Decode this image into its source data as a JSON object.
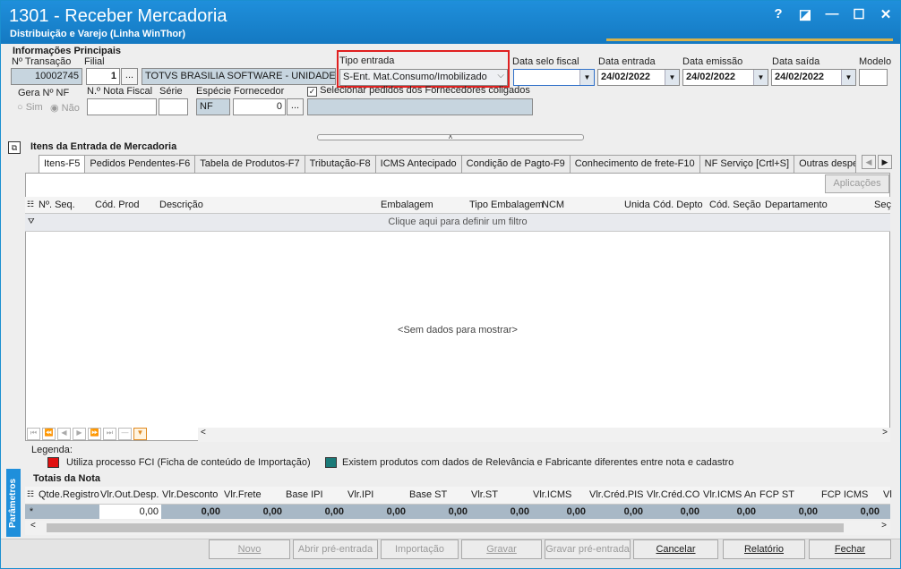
{
  "window": {
    "title": "1301 - Receber Mercadoria",
    "subtitle": "Distribuição e Varejo (Linha WinThor)",
    "controls": [
      "?",
      "◪",
      "—",
      "☐",
      "✕"
    ]
  },
  "main_info": {
    "section_title": "Informações Principais",
    "n_transacao_label": "Nº Transação",
    "n_transacao_value": "10002745",
    "filial_label": "Filial",
    "filial_value": "1",
    "filial_name": "TOTVS BRASILIA SOFTWARE - UNIDADE GOI",
    "tipo_entrada_label": "Tipo entrada",
    "tipo_entrada_value": "S-Ent. Mat.Consumo/Imobilizado",
    "data_selo_label": "Data selo fiscal",
    "data_selo_value": "",
    "data_entrada_label": "Data entrada",
    "data_entrada_value": "24/02/2022",
    "data_emissao_label": "Data emissão",
    "data_emissao_value": "24/02/2022",
    "data_saida_label": "Data saída",
    "data_saida_value": "24/02/2022",
    "modelo_label": "Modelo",
    "modelo_value": "",
    "gera_nf_label": "Gera Nº NF",
    "sim_label": "Sim",
    "nao_label": "Não",
    "nota_fiscal_label": "N.º Nota Fiscal",
    "serie_label": "Série",
    "especie_label": "Espécie",
    "especie_value": "NF",
    "fornecedor_label": "Fornecedor",
    "fornecedor_value": "0",
    "coligados_label": "Selecionar pedidos dos Fornecedores coligados",
    "ellipsis": "..."
  },
  "items": {
    "section_title": "Itens da Entrada de Mercadoria",
    "tabs": [
      "Itens-F5",
      "Pedidos Pendentes-F6",
      "Tabela de Produtos-F7",
      "Tributação-F8",
      "ICMS Antecipado",
      "Condição de Pagto-F9",
      "Conhecimento de frete-F10",
      "NF Serviço [Crtl+S]",
      "Outras despes"
    ],
    "aplicacoes_label": "Aplicações",
    "columns": [
      "Nº. Seq.",
      "Cód. Prod",
      "Descrição",
      "Embalagem",
      "Tipo Embalagem",
      "NCM",
      "Unida",
      "Cód. Depto",
      "Cód. Seção",
      "Departamento",
      "Seç"
    ],
    "filter_hint": "Clique aqui para definir um filtro",
    "empty_text": "<Sem dados para mostrar>"
  },
  "legend": {
    "title": "Legenda:",
    "items": [
      {
        "color": "#e01010",
        "text": "Utiliza processo FCI (Ficha de conteúdo de Importação)"
      },
      {
        "color": "#1a7a78",
        "text": "Existem produtos com dados de Relevância e Fabricante diferentes entre nota e cadastro"
      }
    ]
  },
  "totals": {
    "section_title": "Totais da Nota",
    "side_tab": "Parâmetros",
    "columns": [
      "Qtde.Registro",
      "Vlr.Out.Desp.",
      "Vlr.Desconto",
      "Vlr.Frete",
      "Base IPI",
      "Vlr.IPI",
      "Base ST",
      "Vlr.ST",
      "Vlr.ICMS",
      "Vlr.Créd.PIS",
      "Vlr.Créd.CO",
      "Vlr.ICMS An",
      "FCP ST",
      "FCP ICMS",
      "Vl"
    ],
    "values": [
      "",
      "0,00",
      "0,00",
      "0,00",
      "0,00",
      "0,00",
      "0,00",
      "0,00",
      "0,00",
      "0,00",
      "0,00",
      "0,00",
      "0,00",
      "0,00",
      ""
    ]
  },
  "footer": {
    "novo": "Novo",
    "abrir": "Abrir pré-entrada",
    "importacao": "Importação",
    "gravar": "Gravar",
    "gravar_pre": "Gravar pré-entrada",
    "cancelar": "Cancelar",
    "relatorio": "Relatório",
    "fechar": "Fechar"
  }
}
